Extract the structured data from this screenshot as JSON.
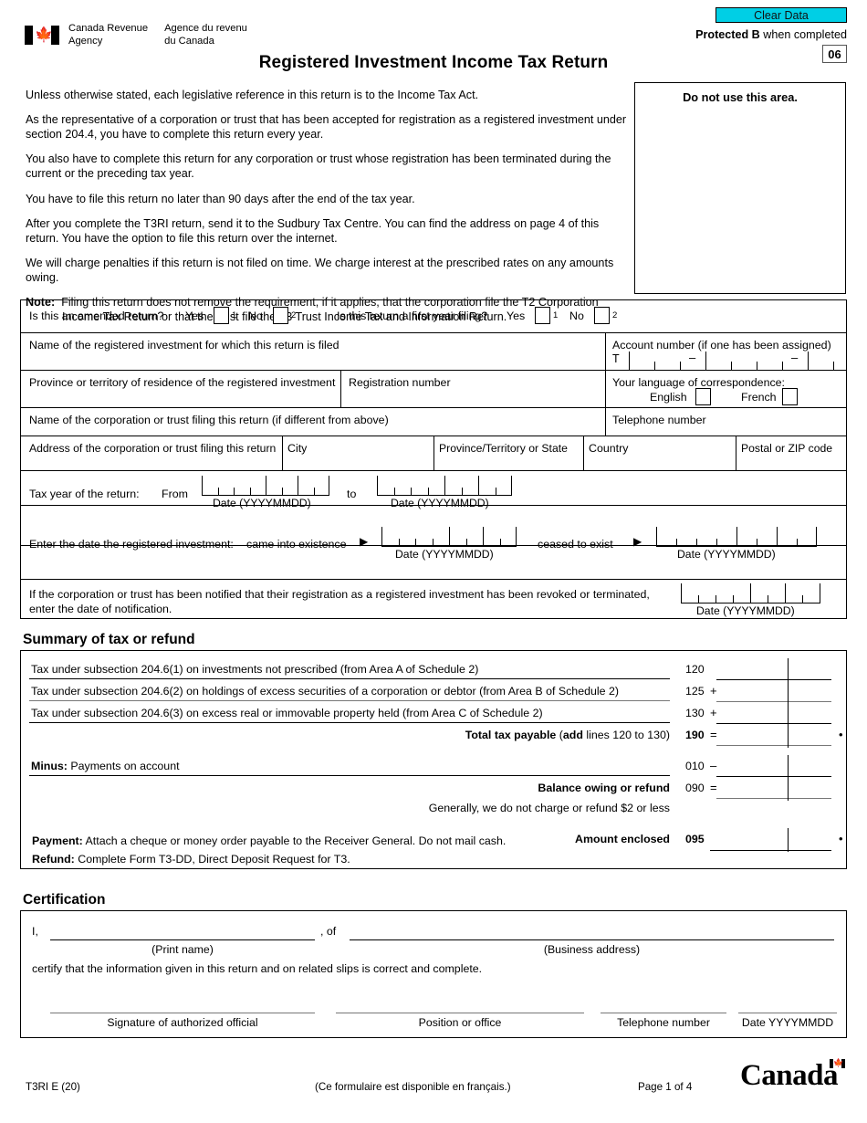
{
  "header": {
    "clear_data_label": "Clear Data",
    "protected_bold": "Protected B",
    "protected_rest": " when completed",
    "code": "06",
    "agency_en": "Canada Revenue\nAgency",
    "agency_fr": "Agence du revenu\ndu Canada",
    "title": "Registered Investment Income Tax Return",
    "clear_data_color": "#00CFE5"
  },
  "intro": {
    "p1": "Unless otherwise stated, each legislative reference in this return is to the Income Tax Act.",
    "p2": "As the representative of a corporation or trust that has been accepted for registration as a registered investment under section 204.4, you have to complete this return every year.",
    "p3": "You also have to complete this return for any corporation or trust whose registration has been terminated during the current or the preceding tax year.",
    "p4": "You have to file this return no later than 90 days after the end of the tax year.",
    "p5": "After you complete the T3RI return, send it to the Sudbury Tax Centre. You can find the address on page 4 of this return. You have the option to file this return over the internet.",
    "p6": "We will charge penalties if this return is not filed on time. We charge interest at the prescribed rates on any amounts owing.",
    "note_label": "Note:",
    "note_text": "Filing this return does not remove the requirement, if it applies, that the corporation file the T2 Corporation Income Tax Return or that the trust file the T3 Trust Income Tax and Information Return.",
    "do_not_use": "Do not use this area."
  },
  "identification": {
    "amended_question": "Is this an amended return?",
    "first_year_question": "Is this return a first year filing?",
    "yes_label": "Yes",
    "no_label": "No",
    "yes_num": "1",
    "no_num": "2",
    "name_registered_investment": "Name of the registered investment for which this return is filed",
    "account_number": "Account number (if one has been assigned)",
    "account_prefix": "T",
    "province_residence": "Province or territory of residence of the registered investment",
    "registration_number": "Registration number",
    "language_label": "Your language of correspondence:",
    "english_label": "English",
    "french_label": "French",
    "name_corporation": "Name of the corporation or trust filing this return (if different from above)",
    "telephone_number": "Telephone number",
    "address_label": "Address of the corporation or trust filing this return",
    "city_label": "City",
    "province_state_label": "Province/Territory or State",
    "country_label": "Country",
    "postal_label": "Postal or ZIP code",
    "tax_year_label": "Tax year of the return:",
    "from_label": "From",
    "to_label": "to",
    "date_format": "Date (YYYYMMDD)",
    "entered_date_label": "Enter the date the registered investment:",
    "came_into_existence": "came into existence",
    "ceased_to_exist": "ceased to exist",
    "revoked_line1": "If the corporation or trust has been notified that their registration as a registered investment has been revoked or terminated,",
    "revoked_line2": "enter the date of notification."
  },
  "summary": {
    "heading": "Summary of tax or refund",
    "rows": [
      {
        "text": "Tax under subsection 204.6(1) on investments not prescribed (from Area A of Schedule 2)",
        "line": "120",
        "op": ""
      },
      {
        "text": "Tax under subsection 204.6(2) on holdings of excess securities of a corporation or debtor (from Area B of Schedule 2)",
        "line": "125",
        "op": "+"
      },
      {
        "text": "Tax under subsection 204.6(3) on excess real or immovable property held (from Area C of Schedule 2)",
        "line": "130",
        "op": "+"
      }
    ],
    "total_bold": "Total tax payable",
    "total_rest_a": " (",
    "total_add": "add",
    "total_rest_b": " lines 120 to 130)",
    "total_line": "190",
    "total_op": "=",
    "minus_bold": "Minus:",
    "minus_text": " Payments on account",
    "minus_line": "010",
    "minus_op": "–",
    "balance_label": "Balance owing or refund",
    "balance_line": "090",
    "balance_op": "=",
    "generally_text": "Generally, we do not charge or refund $2 or less",
    "amount_enclosed_label": "Amount enclosed",
    "amount_enclosed_line": "095",
    "payment_bold": "Payment:",
    "payment_text": " Attach a cheque or money order payable to the Receiver General. Do not mail cash.",
    "refund_bold": "Refund:",
    "refund_text": " Complete Form T3-DD, Direct Deposit Request for T3."
  },
  "certification": {
    "heading": "Certification",
    "i_label": "I,",
    "of_label": ", of",
    "print_name_cap": "(Print name)",
    "business_address_cap": "(Business address)",
    "certify_text": "certify that the information given in this return and on related slips is correct and complete.",
    "signature_cap": "Signature of authorized official",
    "position_cap": "Position or office",
    "telephone_cap": "Telephone number",
    "date_cap": "Date YYYYMMDD"
  },
  "footer": {
    "form_code": "T3RI E (20)",
    "french_note": "(Ce formulaire est disponible en français.)",
    "page_label": "Page 1 of 4",
    "wordmark": "Canada"
  }
}
